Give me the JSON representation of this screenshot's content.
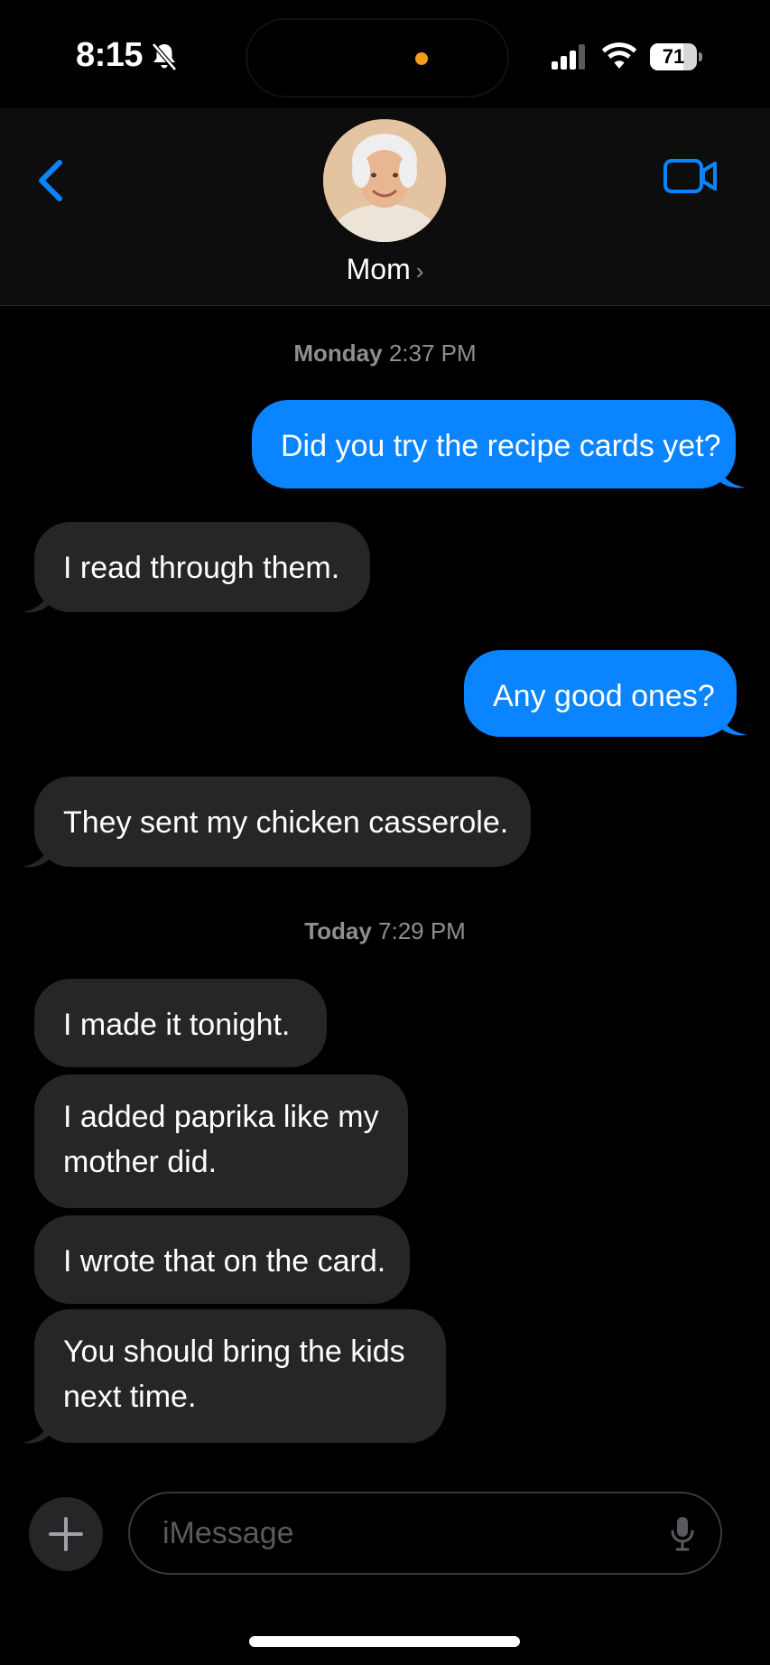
{
  "status_bar": {
    "time": "8:15",
    "battery_level": "71",
    "battery_fraction": 0.71,
    "icons": [
      "bell-slash-icon",
      "cellular-signal-icon",
      "wifi-icon",
      "battery-icon"
    ]
  },
  "header": {
    "contact_name": "Mom",
    "chevron": "›",
    "icons": [
      "chevron-left-icon",
      "video-camera-icon"
    ]
  },
  "colors": {
    "sent_bubble": "#0a84ff",
    "received_bubble": "#262628",
    "accent": "#0a84ff",
    "background": "#000000"
  },
  "conversation": {
    "timestamps": [
      {
        "day": "Monday",
        "time": "2:37 PM"
      },
      {
        "day": "Today",
        "time": "7:29 PM"
      }
    ],
    "messages": [
      {
        "from": "me",
        "text": "Did you try the recipe cards yet?"
      },
      {
        "from": "Mom",
        "text": "I read through them."
      },
      {
        "from": "me",
        "text": "Any good ones?"
      },
      {
        "from": "Mom",
        "text": "They sent my chicken casserole."
      },
      {
        "from": "Mom",
        "text": "I made it tonight."
      },
      {
        "from": "Mom",
        "text": "I added paprika like my mother did."
      },
      {
        "from": "Mom",
        "text": "I wrote that on the card."
      },
      {
        "from": "Mom",
        "text": "You should bring the kids next time."
      }
    ]
  },
  "composer": {
    "placeholder": "iMessage",
    "icons": [
      "plus-icon",
      "microphone-icon"
    ]
  }
}
